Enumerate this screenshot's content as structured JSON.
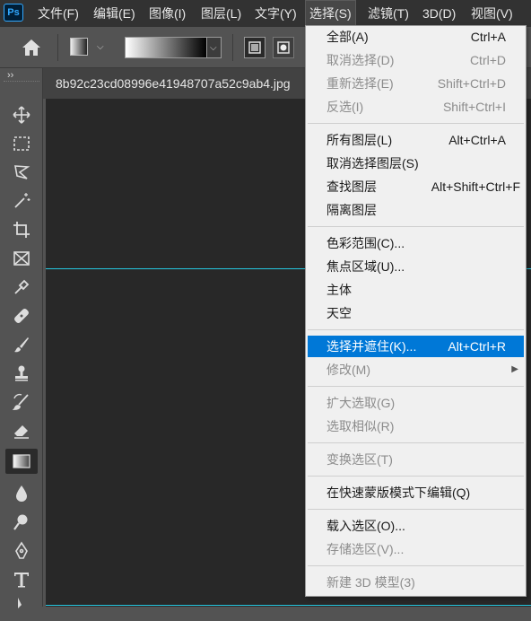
{
  "app": {
    "logo_text": "Ps"
  },
  "menubar": {
    "items": [
      {
        "label": "文件(F)"
      },
      {
        "label": "编辑(E)"
      },
      {
        "label": "图像(I)"
      },
      {
        "label": "图层(L)"
      },
      {
        "label": "文字(Y)"
      },
      {
        "label": "选择(S)",
        "active": true
      },
      {
        "label": "滤镜(T)"
      },
      {
        "label": "3D(D)"
      },
      {
        "label": "视图(V)"
      }
    ]
  },
  "options_bar": {
    "icons": [
      "home-icon",
      "gradient-tool-preset-icon",
      "gradient-preview",
      "linear-gradient-icon",
      "radial-gradient-icon"
    ]
  },
  "toolbar": {
    "collapse_glyph": "››",
    "tools": [
      "move",
      "rectangular-marquee",
      "lasso",
      "magic-wand",
      "crop",
      "frame",
      "eyedropper",
      "healing-brush",
      "brush",
      "clone-stamp",
      "history-brush",
      "eraser",
      "gradient",
      "blur",
      "dodge",
      "pen",
      "type",
      "path-selection"
    ],
    "selected": "gradient"
  },
  "document": {
    "tab_title": "8b92c23cd08996e41948707a52c9ab4.jpg",
    "guide_color": "#25c7e0",
    "canvas_color": "#282828"
  },
  "select_menu": {
    "highlight_color": "#0078d7",
    "groups": [
      [
        {
          "label": "全部(A)",
          "shortcut": "Ctrl+A",
          "disabled": false
        },
        {
          "label": "取消选择(D)",
          "shortcut": "Ctrl+D",
          "disabled": true
        },
        {
          "label": "重新选择(E)",
          "shortcut": "Shift+Ctrl+D",
          "disabled": true
        },
        {
          "label": "反选(I)",
          "shortcut": "Shift+Ctrl+I",
          "disabled": true
        }
      ],
      [
        {
          "label": "所有图层(L)",
          "shortcut": "Alt+Ctrl+A",
          "disabled": false
        },
        {
          "label": "取消选择图层(S)",
          "shortcut": "",
          "disabled": false
        },
        {
          "label": "查找图层",
          "shortcut": "Alt+Shift+Ctrl+F",
          "disabled": false
        },
        {
          "label": "隔离图层",
          "shortcut": "",
          "disabled": false
        }
      ],
      [
        {
          "label": "色彩范围(C)...",
          "shortcut": "",
          "disabled": false
        },
        {
          "label": "焦点区域(U)...",
          "shortcut": "",
          "disabled": false
        },
        {
          "label": "主体",
          "shortcut": "",
          "disabled": false
        },
        {
          "label": "天空",
          "shortcut": "",
          "disabled": false
        }
      ],
      [
        {
          "label": "选择并遮住(K)...",
          "shortcut": "Alt+Ctrl+R",
          "disabled": false,
          "highlighted": true
        },
        {
          "label": "修改(M)",
          "shortcut": "",
          "disabled": true,
          "submenu": true
        }
      ],
      [
        {
          "label": "扩大选取(G)",
          "shortcut": "",
          "disabled": true
        },
        {
          "label": "选取相似(R)",
          "shortcut": "",
          "disabled": true
        }
      ],
      [
        {
          "label": "变换选区(T)",
          "shortcut": "",
          "disabled": true
        }
      ],
      [
        {
          "label": "在快速蒙版模式下编辑(Q)",
          "shortcut": "",
          "disabled": false
        }
      ],
      [
        {
          "label": "载入选区(O)...",
          "shortcut": "",
          "disabled": false
        },
        {
          "label": "存储选区(V)...",
          "shortcut": "",
          "disabled": true
        }
      ],
      [
        {
          "label": "新建 3D 模型(3)",
          "shortcut": "",
          "disabled": true
        }
      ]
    ]
  }
}
